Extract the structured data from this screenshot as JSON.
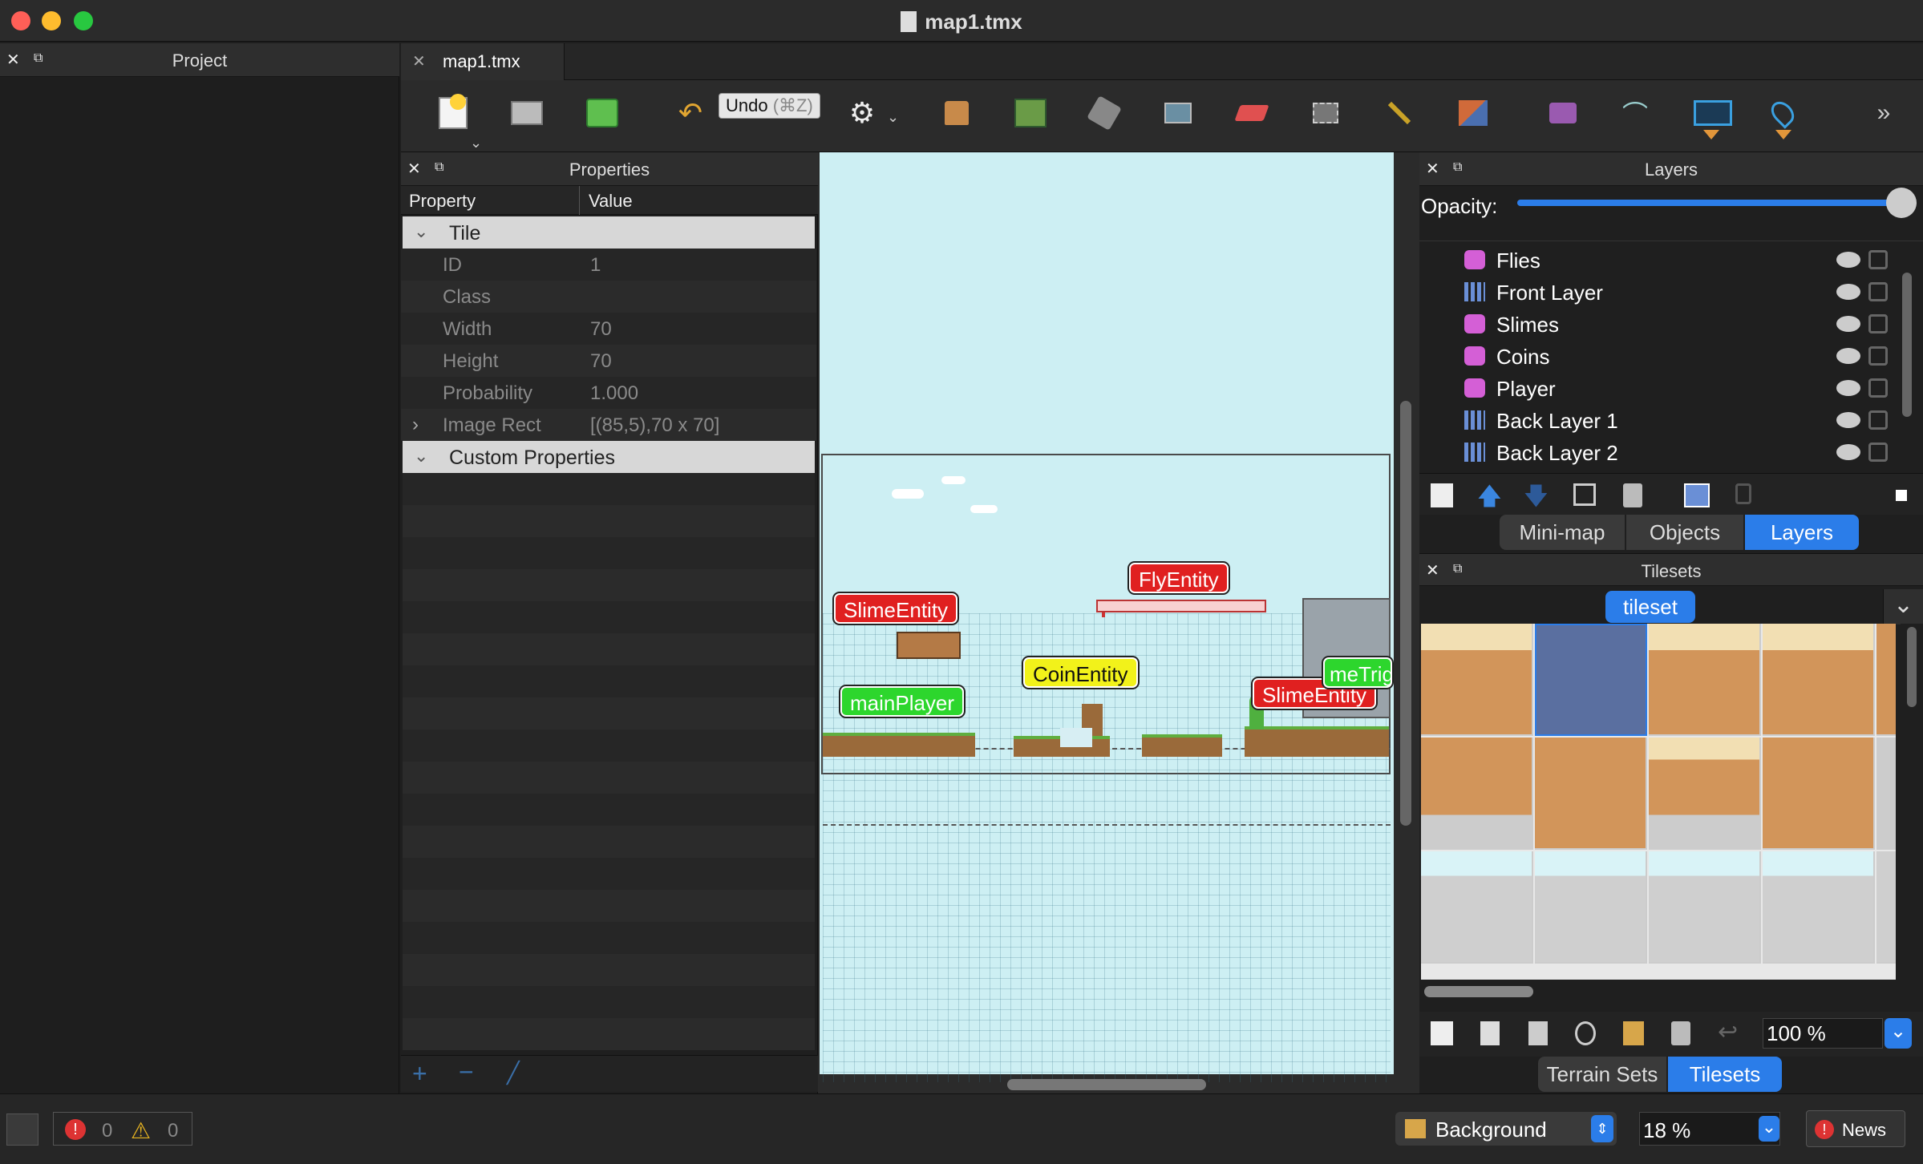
{
  "window": {
    "title": "map1.tmx"
  },
  "project": {
    "title": "Project"
  },
  "doc_tab": {
    "label": "map1.tmx"
  },
  "toolbar": {
    "tooltip_label": "Undo",
    "tooltip_shortcut": "(⌘Z)"
  },
  "properties": {
    "title": "Properties",
    "col_property": "Property",
    "col_value": "Value",
    "group_tile": "Tile",
    "rows": [
      {
        "k": "ID",
        "v": "1"
      },
      {
        "k": "Class",
        "v": ""
      },
      {
        "k": "Width",
        "v": "70"
      },
      {
        "k": "Height",
        "v": "70"
      },
      {
        "k": "Probability",
        "v": "1.000"
      },
      {
        "k": "Image Rect",
        "v": "[(85,5),70 x 70]"
      }
    ],
    "group_custom": "Custom Properties"
  },
  "map": {
    "entities": [
      "SlimeEntity",
      "FlyEntity",
      "mainPlayer",
      "CoinEntity",
      "SlimeEntity",
      "meTrig"
    ]
  },
  "layers_panel": {
    "title": "Layers",
    "opacity_label": "Opacity:",
    "opacity": 1.0,
    "layers": [
      {
        "name": "Flies",
        "kind": "object"
      },
      {
        "name": "Front Layer",
        "kind": "tile"
      },
      {
        "name": "Slimes",
        "kind": "object"
      },
      {
        "name": "Coins",
        "kind": "object"
      },
      {
        "name": "Player",
        "kind": "object"
      },
      {
        "name": "Back Layer 1",
        "kind": "tile"
      },
      {
        "name": "Back Layer 2",
        "kind": "tile"
      }
    ],
    "tabs": [
      "Mini-map",
      "Objects",
      "Layers"
    ],
    "active_tab": "Layers"
  },
  "tilesets_panel": {
    "title": "Tilesets",
    "tileset_tab": "tileset",
    "zoom": "100 %",
    "tabs": [
      "Terrain Sets",
      "Tilesets"
    ],
    "active_tab": "Tilesets"
  },
  "statusbar": {
    "errors": "0",
    "warnings": "0",
    "layer_select": "Background",
    "zoom": "18 %",
    "news": "News"
  }
}
